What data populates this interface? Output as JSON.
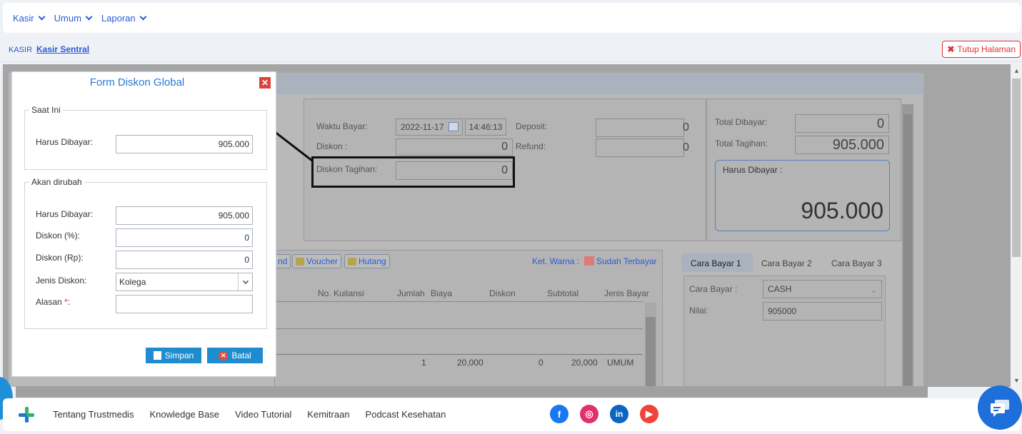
{
  "topnav": {
    "menus": [
      "Kasir",
      "Umum",
      "Laporan"
    ]
  },
  "breadcrumb": {
    "section": "KASIR",
    "current": "Kasir Sentral"
  },
  "close_page_label": "Tutup Halaman",
  "payment": {
    "waktu_bayar_label": "Waktu Bayar:",
    "date": "2022-11-17",
    "time": "14:46:13",
    "deposit_label": "Deposit:",
    "deposit_value": "0",
    "diskon_label": "Diskon :",
    "diskon_value": "0",
    "refund_label": "Refund:",
    "refund_value": "0",
    "diskon_tagihan_label": "Diskon Tagihan:",
    "diskon_tagihan_value": "0",
    "total_dibayar_label": "Total Dibayar:",
    "total_dibayar_value": "0",
    "total_tagihan_label": "Total Tagihan:",
    "total_tagihan_value": "905.000",
    "harus_dibayar_label": "Harus Dibayar :",
    "harus_dibayar_value": "905.000"
  },
  "table": {
    "buttons": [
      "nd",
      "Voucher",
      "Hutang"
    ],
    "ket_warna_label": "Ket. Warna :",
    "sudah_terbayar_label": "Sudah Terbayar",
    "headers": [
      "No. Kuitansi",
      "Jumlah",
      "Biaya",
      "Diskon",
      "Subtotal",
      "Jenis Bayar"
    ],
    "row": {
      "jumlah": "1",
      "biaya": "20,000",
      "diskon": "0",
      "subtotal": "20,000",
      "jenis_bayar": "UMUM"
    }
  },
  "cara_bayar": {
    "tabs": [
      "Cara Bayar 1",
      "Cara Bayar 2",
      "Cara Bayar 3"
    ],
    "cara_bayar_label": "Cara Bayar :",
    "cara_bayar_value": "CASH",
    "nilai_label": "Nilai:",
    "nilai_value": "905000"
  },
  "modal": {
    "title": "Form Diskon Global",
    "saat_ini_legend": "Saat Ini",
    "harus_dibayar_label": "Harus Dibayar:",
    "harus_dibayar_current": "905.000",
    "akan_dirubah_legend": "Akan dirubah",
    "harus_dibayar_new": "905.000",
    "diskon_persen_label": "Diskon (%):",
    "diskon_persen_value": "0",
    "diskon_rp_label": "Diskon (Rp):",
    "diskon_rp_value": "0",
    "jenis_diskon_label": "Jenis Diskon:",
    "jenis_diskon_value": "Kolega",
    "alasan_label": "Alasan",
    "alasan_required": "*:",
    "alasan_value": "",
    "simpan_label": "Simpan",
    "batal_label": "Batal"
  },
  "footer": {
    "links": [
      "Tentang Trustmedis",
      "Knowledge Base",
      "Video Tutorial",
      "Kemitraan",
      "Podcast Kesehatan"
    ],
    "socials": [
      "facebook-icon",
      "instagram-icon",
      "linkedin-icon",
      "youtube-icon"
    ]
  },
  "colors": {
    "accent": "#2a5bd7",
    "danger": "#d33333",
    "button": "#1e8ccf",
    "chat": "#1e6fd9"
  }
}
